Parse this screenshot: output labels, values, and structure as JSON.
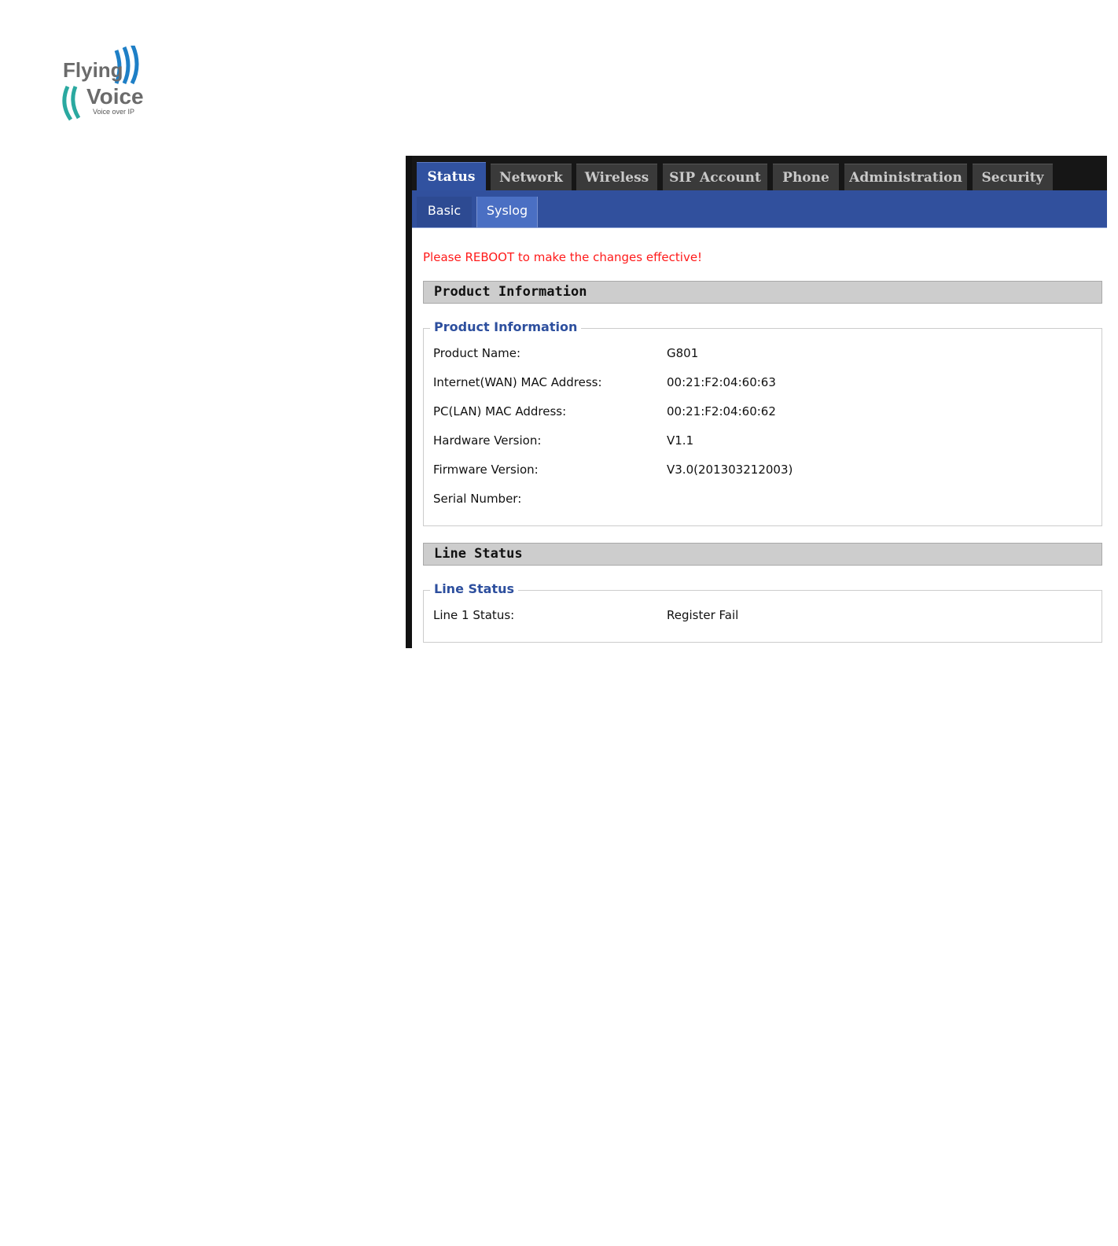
{
  "logo": {
    "line1": "Flying",
    "line2": "Voice",
    "tagline": "Voice over IP",
    "colors": {
      "text": "#6b6b6b",
      "wave_blue": "#1e7fc6",
      "wave_teal": "#2aa9a0"
    }
  },
  "nav": {
    "tabs": [
      {
        "label": "Status",
        "active": true
      },
      {
        "label": "Network",
        "active": false
      },
      {
        "label": "Wireless",
        "active": false
      },
      {
        "label": "SIP Account",
        "active": false
      },
      {
        "label": "Phone",
        "active": false
      },
      {
        "label": "Administration",
        "active": false
      },
      {
        "label": "Security",
        "active": false
      }
    ],
    "subtabs": [
      {
        "label": "Basic",
        "active": true
      },
      {
        "label": "Syslog",
        "active": false
      }
    ]
  },
  "notice": "Please REBOOT to make the changes effective!",
  "product_section": {
    "header": "Product Information",
    "legend": "Product Information",
    "rows": [
      {
        "label": "Product Name:",
        "value": "G801"
      },
      {
        "label": "Internet(WAN) MAC Address:",
        "value": "00:21:F2:04:60:63"
      },
      {
        "label": "PC(LAN) MAC Address:",
        "value": "00:21:F2:04:60:62"
      },
      {
        "label": "Hardware Version:",
        "value": "V1.1"
      },
      {
        "label": "Firmware Version:",
        "value": "V3.0(201303212003)"
      },
      {
        "label": "Serial Number:",
        "value": ""
      }
    ]
  },
  "line_section": {
    "header": "Line Status",
    "legend": "Line Status",
    "rows": [
      {
        "label": "Line 1 Status:",
        "value": "Register Fail"
      }
    ]
  },
  "colors": {
    "tab_active": "#3152a0",
    "tab_inactive": "#3a3a3a",
    "subbar": "#31509d",
    "notice": "#ff1a1a",
    "legend": "#2d4f9e"
  }
}
